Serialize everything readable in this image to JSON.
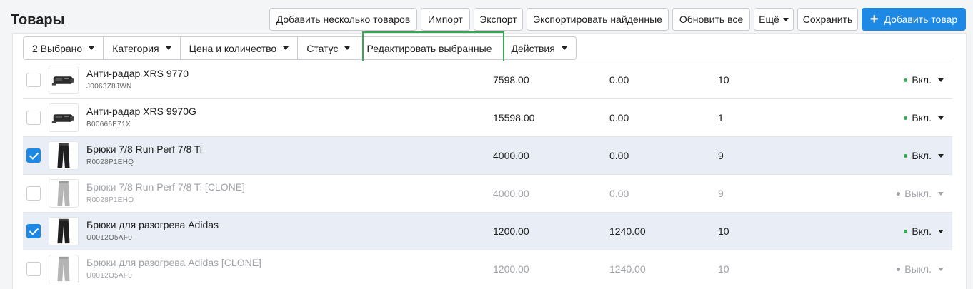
{
  "page": {
    "title": "Товары"
  },
  "toolbar": {
    "add_many": "Добавить несколько товаров",
    "import": "Импорт",
    "export": "Экспорт",
    "export_found": "Экспортировать найденные",
    "update_all": "Обновить все",
    "more": "Ещё",
    "save": "Сохранить",
    "add_product": "Добавить товар"
  },
  "filters": {
    "selected": "2 Выбрано",
    "category": "Категория",
    "price_qty": "Цена и количество",
    "status": "Статус",
    "edit_selected": "Редактировать выбранные",
    "actions": "Действия"
  },
  "products": [
    {
      "name": "Анти-радар XRS 9770",
      "sku": "J0063Z8JWN",
      "price": "7598.00",
      "list_price": "0.00",
      "qty": "10",
      "status": "Вкл.",
      "checked": false,
      "disabled": false,
      "thumb": "radar"
    },
    {
      "name": "Анти-радар XRS 9970G",
      "sku": "B00666E71X",
      "price": "15598.00",
      "list_price": "0.00",
      "qty": "1",
      "status": "Вкл.",
      "checked": false,
      "disabled": false,
      "thumb": "radar"
    },
    {
      "name": "Брюки 7/8 Run Perf 7/8 Ti",
      "sku": "R0028P1EHQ",
      "price": "4000.00",
      "list_price": "0.00",
      "qty": "9",
      "status": "Вкл.",
      "checked": true,
      "disabled": false,
      "thumb": "pants-black"
    },
    {
      "name": "Брюки 7/8 Run Perf 7/8 Ti [CLONE]",
      "sku": "R0028P1EHQ",
      "price": "4000.00",
      "list_price": "0.00",
      "qty": "9",
      "status": "Выкл.",
      "checked": false,
      "disabled": true,
      "thumb": "pants-grey"
    },
    {
      "name": "Брюки для разогрева Adidas",
      "sku": "U0012O5AF0",
      "price": "1200.00",
      "list_price": "1240.00",
      "qty": "10",
      "status": "Вкл.",
      "checked": true,
      "disabled": false,
      "thumb": "pants-black"
    },
    {
      "name": "Брюки для разогрева Adidas [CLONE]",
      "sku": "U0012O5AF0",
      "price": "1200.00",
      "list_price": "1240.00",
      "qty": "10",
      "status": "Выкл.",
      "checked": false,
      "disabled": true,
      "thumb": "pants-grey"
    }
  ]
}
